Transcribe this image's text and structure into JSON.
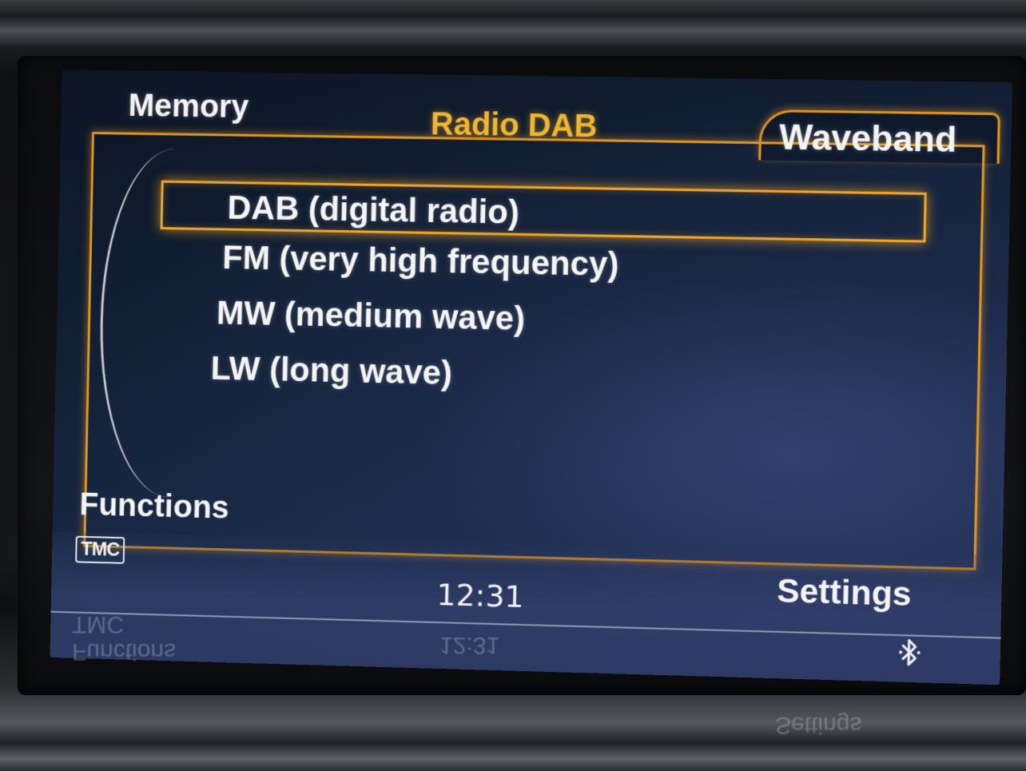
{
  "header": {
    "left": "Memory",
    "title": "Radio DAB",
    "right_tab": "Waveband"
  },
  "waveband_list": {
    "selected_index": 0,
    "items": [
      {
        "label": "DAB (digital radio)"
      },
      {
        "label": "FM (very high frequency)"
      },
      {
        "label": "MW (medium wave)"
      },
      {
        "label": "LW (long wave)"
      }
    ]
  },
  "footer": {
    "functions": "Functions",
    "settings": "Settings",
    "tmc_badge": "TMC",
    "clock": "12:31",
    "bluetooth_icon": "bluetooth-icon"
  },
  "colors": {
    "accent": "#f2b530",
    "frame": "#e0951e",
    "background": "#132238"
  }
}
